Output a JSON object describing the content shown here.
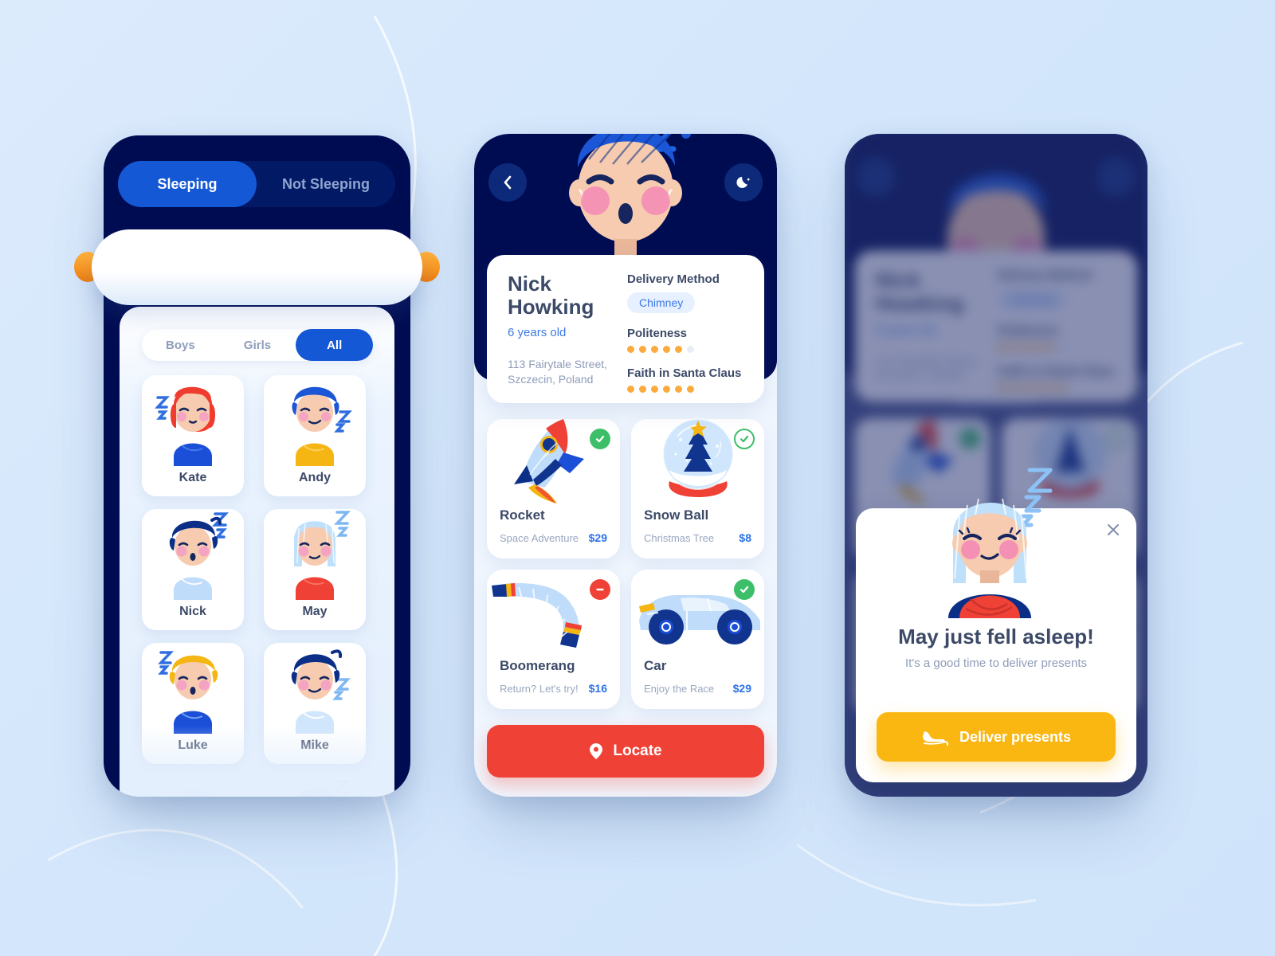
{
  "theme": {
    "bg": "#d5e8fb",
    "navy": "#000c52",
    "blue": "#1558d6",
    "link_blue": "#2b72e8",
    "red": "#ef4136",
    "green": "#3dbf6a",
    "yellow": "#fbb711",
    "orange_dot": "#fbab3d",
    "text_dark": "#3c4a68",
    "text_muted": "#8e9cb8"
  },
  "phone1": {
    "segments": [
      {
        "label": "Sleeping",
        "active": true
      },
      {
        "label": "Not Sleeping",
        "active": false
      }
    ],
    "search": {
      "value": "",
      "placeholder": ""
    },
    "filters": [
      {
        "label": "Boys",
        "active": false
      },
      {
        "label": "Girls",
        "active": false
      },
      {
        "label": "All",
        "active": true
      }
    ],
    "kids": [
      {
        "name": "Kate",
        "hair": "#f03c2e",
        "shirt": "#1b4fd8",
        "style": "girl-red"
      },
      {
        "name": "Andy",
        "hair": "#1a56d6",
        "shirt": "#f5b513",
        "style": "boy-blue"
      },
      {
        "name": "Nick",
        "hair": "#0b2f86",
        "shirt": "#bfdcfb",
        "style": "boy-dark"
      },
      {
        "name": "May",
        "hair": "#bfe0fb",
        "shirt": "#ef4136",
        "style": "girl-lightblue"
      },
      {
        "name": "Luke",
        "hair": "#f5b513",
        "shirt": "#1b4fd8",
        "style": "boy-blonde"
      },
      {
        "name": "Mike",
        "hair": "#0b2f86",
        "shirt": "#cfe6fc",
        "style": "boy-dark2"
      }
    ]
  },
  "phone2": {
    "nav": {
      "back_icon": "chevron-left-icon",
      "moon_icon": "moon-icon"
    },
    "profile": {
      "name": "Nick Howking",
      "age": "6 years old",
      "address": "113 Fairytale Street, Szczecin, Poland",
      "delivery_label": "Delivery Method",
      "delivery_value": "Chimney",
      "politeness_label": "Politeness",
      "politeness_filled": 5,
      "politeness_total": 6,
      "faith_label": "Faith in Santa Claus",
      "faith_filled": 6,
      "faith_total": 6
    },
    "gifts": [
      {
        "title": "Rocket",
        "subtitle": "Space Adventure",
        "price": "$29",
        "status": "approved",
        "art": "rocket-illustration"
      },
      {
        "title": "Snow Ball",
        "subtitle": "Christmas Tree",
        "price": "$8",
        "status": "approved-outline",
        "art": "snowglobe-illustration"
      },
      {
        "title": "Boomerang",
        "subtitle": "Return? Let's try!",
        "price": "$16",
        "status": "rejected",
        "art": "boomerang-illustration"
      },
      {
        "title": "Car",
        "subtitle": "Enjoy the Race",
        "price": "$29",
        "status": "approved",
        "art": "car-illustration"
      }
    ],
    "locate_button": {
      "label": "Locate",
      "icon": "map-pin-icon"
    }
  },
  "phone3": {
    "modal": {
      "title": "May just fell asleep!",
      "subtitle": "It's a good time to deliver presents",
      "button_label": "Deliver presents",
      "button_icon": "sleigh-icon",
      "close_icon": "close-icon",
      "avatar": "may-sleeping-avatar"
    }
  }
}
